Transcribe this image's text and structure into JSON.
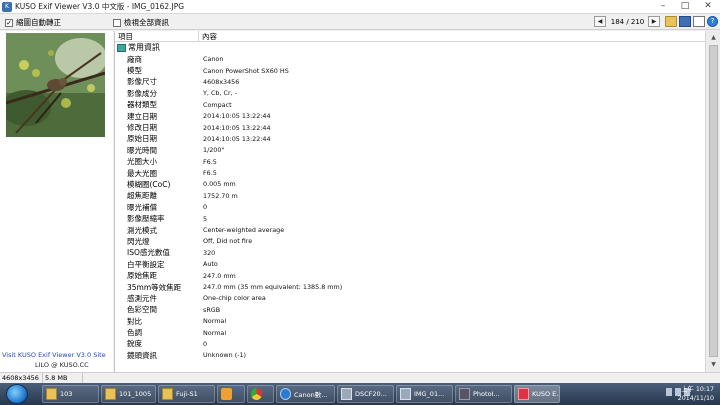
{
  "window": {
    "title": "KUSO Exif Viewer V3.0 中文版 - IMG_0162.JPG",
    "minimize": "–",
    "maximize": "□",
    "close": "✕"
  },
  "toolbar": {
    "auto_rotate_label": "縮圖自動轉正",
    "auto_rotate_checked": "✓",
    "show_all_label": "檢視全部資訊",
    "prev": "◀",
    "next": "▶",
    "counter": "184 / 210",
    "help": "?"
  },
  "sidebar": {
    "promo": "Visit KUSO Exif Viewer V3.0 Site",
    "promo2": "LILO @ KUSO.CC"
  },
  "table": {
    "col_item": "項目",
    "col_value": "內容",
    "group": "常用資訊",
    "rows": [
      {
        "k": "廠商",
        "v": "Canon"
      },
      {
        "k": "模型",
        "v": "Canon PowerShot SX60 HS"
      },
      {
        "k": "影像尺寸",
        "v": "4608x3456"
      },
      {
        "k": "影像成分",
        "v": "Y, Cb, Cr, -"
      },
      {
        "k": "器材類型",
        "v": "Compact"
      },
      {
        "k": "建立日期",
        "v": "2014:10:05 13:22:44"
      },
      {
        "k": "修改日期",
        "v": "2014:10:05 13:22:44"
      },
      {
        "k": "原始日期",
        "v": "2014:10:05 13:22:44"
      },
      {
        "k": "曝光時間",
        "v": "1/200\""
      },
      {
        "k": "光圈大小",
        "v": "F6.5"
      },
      {
        "k": "最大光圈",
        "v": "F6.5"
      },
      {
        "k": "模糊圈(CoC)",
        "v": "0.005 mm"
      },
      {
        "k": "超焦距離",
        "v": "1752.70 m"
      },
      {
        "k": "曝光補償",
        "v": "0"
      },
      {
        "k": "影像壓縮率",
        "v": "5"
      },
      {
        "k": "測光模式",
        "v": "Center-weighted average"
      },
      {
        "k": "閃光燈",
        "v": "Off, Did not fire"
      },
      {
        "k": "ISO感光數值",
        "v": "320"
      },
      {
        "k": "白平衡設定",
        "v": "Auto"
      },
      {
        "k": "原始焦距",
        "v": "247.0 mm"
      },
      {
        "k": "35mm等效焦距",
        "v": "247.0 mm (35 mm equivalent: 1385.8 mm)"
      },
      {
        "k": "感測元件",
        "v": "One-chip color area"
      },
      {
        "k": "色彩空間",
        "v": "sRGB"
      },
      {
        "k": "對比",
        "v": "Normal"
      },
      {
        "k": "色調",
        "v": "Normal"
      },
      {
        "k": "銳度",
        "v": "0"
      },
      {
        "k": "鏡頭資訊",
        "v": "Unknown (-1)"
      }
    ]
  },
  "statusbar": {
    "dimensions": "4608x3456",
    "size": "5.8 MB"
  },
  "taskbar": {
    "items": [
      {
        "label": "103",
        "icon": "folder"
      },
      {
        "label": "101_1005",
        "icon": "folder"
      },
      {
        "label": "Fuji-S1",
        "icon": "folder"
      },
      {
        "label": "",
        "icon": "media"
      },
      {
        "label": "",
        "icon": "chrome"
      },
      {
        "label": "Canon數...",
        "icon": "ie"
      },
      {
        "label": "DSCF20...",
        "icon": "pic"
      },
      {
        "label": "IMG_01...",
        "icon": "pic"
      },
      {
        "label": "PhotoI...",
        "icon": "photo"
      },
      {
        "label": "KUSO E...",
        "icon": "kuso"
      }
    ],
    "clock_time": "上午 10:17",
    "clock_date": "2014/11/10"
  }
}
